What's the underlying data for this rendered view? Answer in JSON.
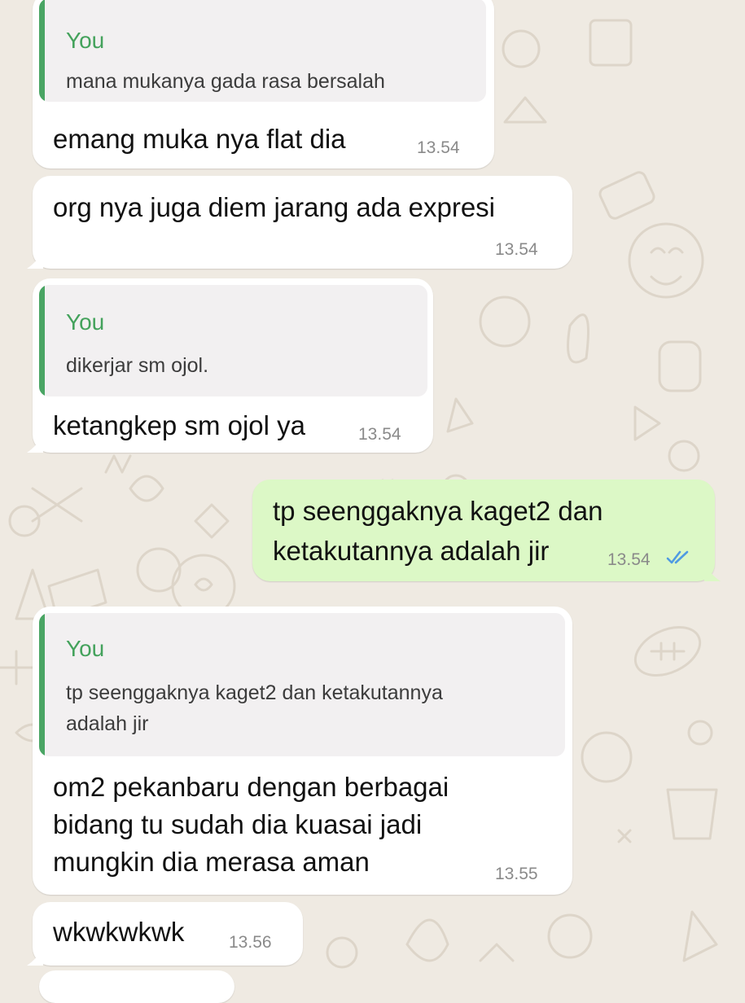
{
  "colors": {
    "background": "#efeae2",
    "incoming_bubble": "#ffffff",
    "outgoing_bubble": "#dcf8c6",
    "quote_accent": "#44a25c",
    "read_ticks": "#4f9ae2"
  },
  "messages": [
    {
      "direction": "incoming",
      "quote": {
        "author": "You",
        "text": "mana mukanya gada rasa bersalah"
      },
      "text": "emang muka nya flat dia",
      "time": "13.54"
    },
    {
      "direction": "incoming",
      "text": "org nya juga diem jarang ada expresi",
      "time": "13.54"
    },
    {
      "direction": "incoming",
      "quote": {
        "author": "You",
        "text": "dikerjar sm ojol."
      },
      "text": "ketangkep sm ojol ya",
      "time": "13.54"
    },
    {
      "direction": "outgoing",
      "text_lines": [
        "tp seenggaknya kaget2 dan",
        "ketakutannya adalah jir"
      ],
      "time": "13.54",
      "status_icon": "double-check-read-icon"
    },
    {
      "direction": "incoming",
      "quote": {
        "author": "You",
        "text_lines": [
          "tp seenggaknya kaget2 dan ketakutannya",
          "adalah jir"
        ]
      },
      "text_lines": [
        "om2 pekanbaru dengan berbagai",
        "bidang tu sudah dia kuasai jadi",
        "mungkin dia merasa aman"
      ],
      "time": "13.55"
    },
    {
      "direction": "incoming",
      "text": "wkwkwkwk",
      "time": "13.56"
    }
  ]
}
